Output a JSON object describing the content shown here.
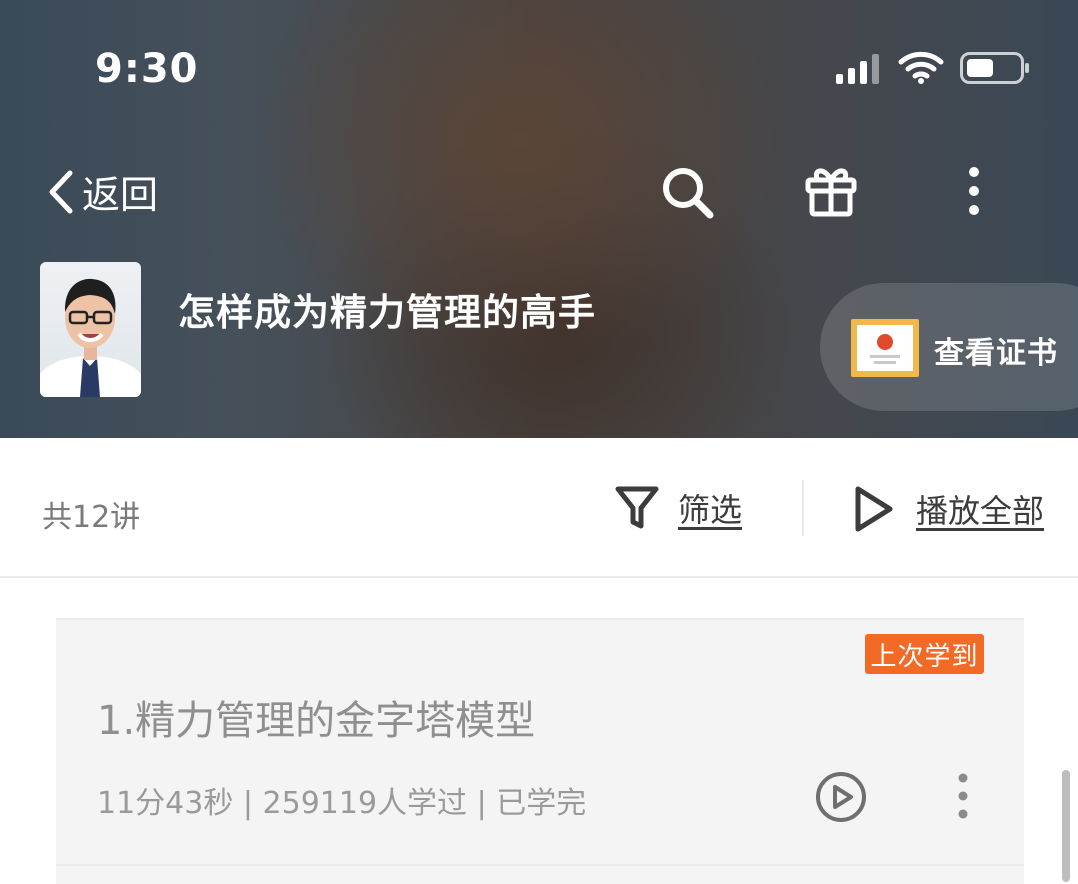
{
  "status_bar": {
    "time": "9:30"
  },
  "nav": {
    "back_label": "返回",
    "icons": [
      "search-icon",
      "gift-icon",
      "more-vertical-icon"
    ]
  },
  "course": {
    "title": "怎样成为精力管理的高手",
    "certificate_label": "查看证书"
  },
  "toolbar": {
    "count_label": "共12讲",
    "filter_label": "筛选",
    "play_all_label": "播放全部"
  },
  "lessons": [
    {
      "title": "1.精力管理的金字塔模型",
      "meta": "11分43秒 | 259119人学过 | 已学完",
      "badge": "上次学到"
    }
  ],
  "colors": {
    "accent_orange": "#f26a26",
    "certificate_gold": "#f0b94a",
    "text_dark": "#3c3c3c",
    "text_muted": "#9a9a9a"
  }
}
